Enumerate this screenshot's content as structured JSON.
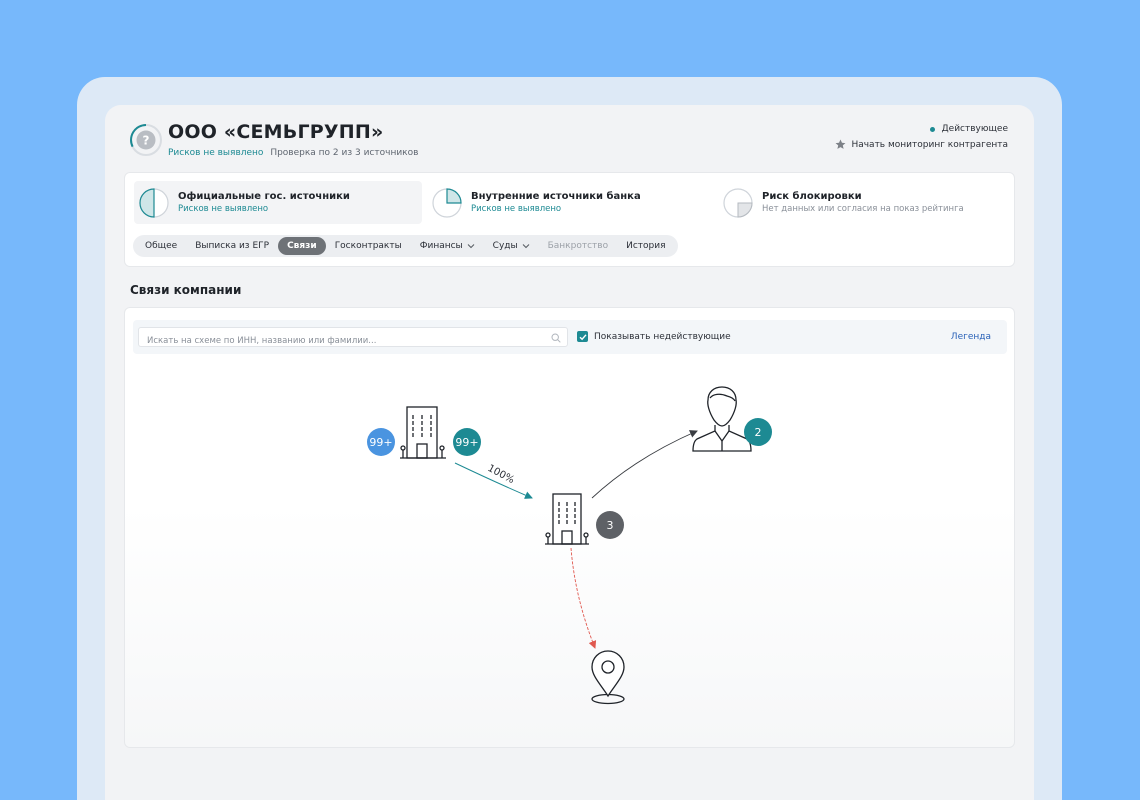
{
  "company": {
    "name": "ООО «СЕМЬГРУПП»",
    "risk_status": "Рисков не выявлено",
    "check_info": "Проверка по 2 из 3 источников",
    "status": "Действующее",
    "monitor_label": "Начать мониторинг контрагента"
  },
  "sources": [
    {
      "title": "Официальные гос. источники",
      "subtitle": "Рисков не выявлено"
    },
    {
      "title": "Внутренние источники банка",
      "subtitle": "Рисков не выявлено"
    },
    {
      "title": "Риск блокировки",
      "subtitle": "Нет данных или согласия на показ рейтинга"
    }
  ],
  "tabs": [
    {
      "label": "Общее"
    },
    {
      "label": "Выписка из ЕГР"
    },
    {
      "label": "Связи"
    },
    {
      "label": "Госконтракты"
    },
    {
      "label": "Финансы"
    },
    {
      "label": "Суды"
    },
    {
      "label": "Банкротство"
    },
    {
      "label": "История"
    }
  ],
  "section_title": "Связи компании",
  "graph_toolbar": {
    "search_placeholder": "Искать на схеме по ИНН, названию или фамилии...",
    "show_inactive_label": "Показывать недействующие",
    "legend_label": "Легенда"
  },
  "graph": {
    "badges": {
      "parent_left": "99+",
      "parent_right": "99+",
      "person": "2",
      "company": "3"
    },
    "edge_label": "100%"
  },
  "colors": {
    "accent": "#1d8a93",
    "badge_blue": "#4a94e0",
    "badge_gray": "#5e6166",
    "edge_red": "#e0584f"
  }
}
